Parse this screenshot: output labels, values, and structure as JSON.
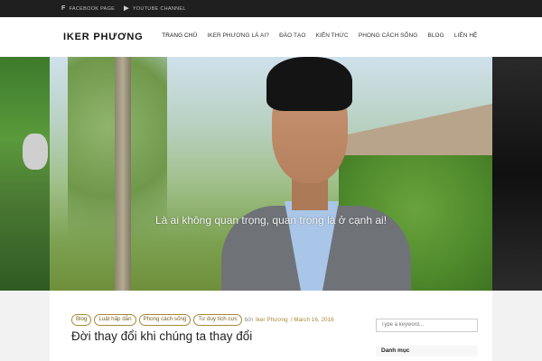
{
  "topbar": {
    "links": [
      {
        "icon": "facebook-icon",
        "glyph": "f",
        "label": "FACEBOOK PAGE"
      },
      {
        "icon": "youtube-icon",
        "glyph": "▶",
        "label": "YOUTUBE CHANNEL"
      }
    ]
  },
  "header": {
    "logo": "IKER PHƯƠNG",
    "nav": [
      "TRANG CHỦ",
      "IKER PHƯƠNG LÀ AI?",
      "ĐÀO TẠO",
      "KIẾN THỨC",
      "PHONG CÁCH SỐNG",
      "BLOG",
      "LIÊN HỆ"
    ]
  },
  "hero": {
    "tagline": "Là ai không quan trọng, quan trọng là ở cạnh ai!"
  },
  "post": {
    "tags": [
      "Blog",
      "Luật hấp dẫn",
      "Phong cách sống",
      "Tư duy tích cực"
    ],
    "by": "bởi",
    "author": "Iker Phương",
    "date": "/ March 16, 2016",
    "title": "Đời thay đổi khi chúng ta thay đổi"
  },
  "sidebar": {
    "search_placeholder": "Type a keyword...",
    "widget_title": "Danh mục"
  }
}
